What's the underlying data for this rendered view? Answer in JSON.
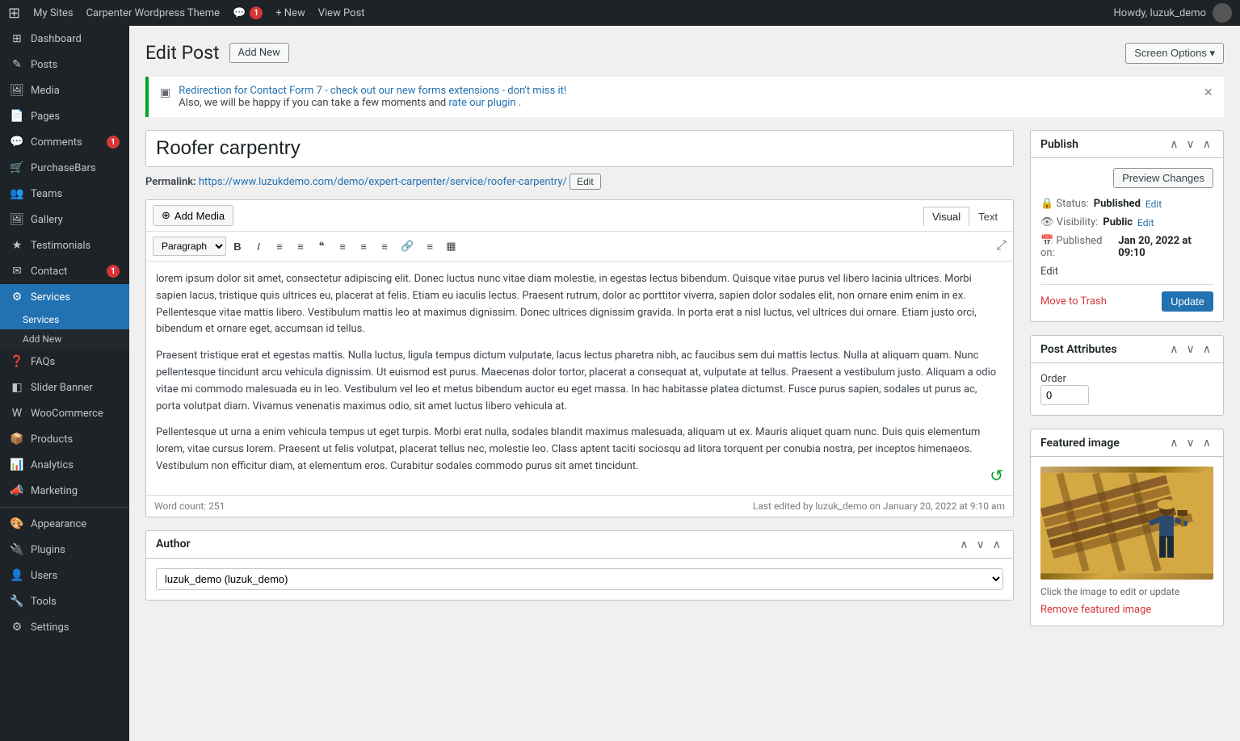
{
  "adminbar": {
    "wp_logo": "⊞",
    "my_sites": "My Sites",
    "theme_name": "Carpenter Wordpress Theme",
    "comments_count": "1",
    "new_label": "+ New",
    "view_post": "View Post",
    "howdy": "Howdy, luzuk_demo"
  },
  "screen_options": "Screen Options ▾",
  "sidebar": {
    "items": [
      {
        "label": "Dashboard",
        "icon": "⊞",
        "active": false
      },
      {
        "label": "Posts",
        "icon": "✎",
        "active": false
      },
      {
        "label": "Media",
        "icon": "🖼",
        "active": false
      },
      {
        "label": "Pages",
        "icon": "📄",
        "active": false
      },
      {
        "label": "Comments",
        "icon": "💬",
        "badge": "1",
        "active": false
      },
      {
        "label": "PurchaseBars",
        "icon": "🛒",
        "active": false
      },
      {
        "label": "Teams",
        "icon": "👥",
        "active": false
      },
      {
        "label": "Gallery",
        "icon": "🖼",
        "active": false
      },
      {
        "label": "Testimonials",
        "icon": "★",
        "active": false
      },
      {
        "label": "Contact",
        "icon": "✉",
        "badge": "1",
        "active": false
      },
      {
        "label": "Services",
        "icon": "⚙",
        "active": true
      },
      {
        "label": "FAQs",
        "icon": "❓",
        "active": false
      },
      {
        "label": "Slider Banner",
        "icon": "◧",
        "active": false
      },
      {
        "label": "WooCommerce",
        "icon": "W",
        "active": false
      },
      {
        "label": "Products",
        "icon": "📦",
        "active": false
      },
      {
        "label": "Analytics",
        "icon": "📊",
        "active": false
      },
      {
        "label": "Marketing",
        "icon": "📣",
        "active": false
      },
      {
        "label": "Appearance",
        "icon": "🎨",
        "active": false
      },
      {
        "label": "Plugins",
        "icon": "🔌",
        "active": false
      },
      {
        "label": "Users",
        "icon": "👤",
        "active": false
      },
      {
        "label": "Tools",
        "icon": "🔧",
        "active": false
      },
      {
        "label": "Settings",
        "icon": "⚙",
        "active": false
      }
    ],
    "submenu": {
      "parent": "Services",
      "items": [
        {
          "label": "Services",
          "active": true
        },
        {
          "label": "Add New",
          "active": false
        }
      ]
    }
  },
  "page": {
    "title": "Edit Post",
    "add_new": "Add New"
  },
  "notice": {
    "link_text": "Redirection for Contact Form 7 - check out our new forms extensions - don't miss it!",
    "body": "Also, we will be happy if you can take a few moments and ",
    "rate_link": "rate our plugin",
    "rate_suffix": "."
  },
  "post": {
    "title": "Roofer carpentry",
    "permalink_label": "Permalink:",
    "permalink_url": "https://www.luzukdemo.com/demo/expert-carpenter/service/roofer-carpentry/",
    "edit_btn": "Edit",
    "content_p1": "lorem ipsum dolor sit amet, consectetur adipiscing elit. Donec luctus nunc vitae diam molestie, in egestas lectus bibendum. Quisque vitae purus vel libero lacinia ultrices. Morbi sapien lacus, tristique quis ultrices eu, placerat at felis. Etiam eu iaculis lectus. Praesent rutrum, dolor ac porttitor viverra, sapien dolor sodales elit, non ornare enim enim in ex. Pellentesque vitae mattis libero. Vestibulum mattis leo at maximus dignissim. Donec ultrices dignissim gravida. In porta erat a nisl luctus, vel ultrices dui ornare. Etiam justo orci, bibendum et ornare eget, accumsan id tellus.",
    "content_p2": "Praesent tristique erat et egestas mattis. Nulla luctus, ligula tempus dictum vulputate, lacus lectus pharetra nibh, ac faucibus sem dui mattis lectus. Nulla at aliquam quam. Nunc pellentesque tincidunt arcu vehicula dignissim. Ut euismod est purus. Maecenas dolor tortor, placerat a consequat at, vulputate at tellus. Praesent a vestibulum justo. Aliquam a odio vitae mi commodo malesuada eu in leo. Vestibulum vel leo et metus bibendum auctor eu eget massa. In hac habitasse platea dictumst. Fusce purus sapien, sodales ut purus ac, porta volutpat diam. Vivamus venenatis maximus odio, sit amet luctus libero vehicula at.",
    "content_p3": "Pellentesque ut urna a enim vehicula tempus ut eget turpis. Morbi erat nulla, sodales blandit maximus malesuada, aliquam ut ex. Mauris aliquet quam nunc. Duis quis elementum lorem, vitae cursus lorem. Praesent ut felis volutpat, placerat tellus nec, molestie leo. Class aptent taciti sociosqu ad litora torquent per conubia nostra, per inceptos himenaeos. Vestibulum non efficitur diam, at elementum eros. Curabitur sodales commodo purus sit amet tincidunt.",
    "word_count": "Word count: 251",
    "last_edited": "Last edited by luzuk_demo on January 20, 2022 at 9:10 am"
  },
  "toolbar": {
    "add_media": "Add Media",
    "visual_tab": "Visual",
    "text_tab": "Text",
    "paragraph_option": "Paragraph",
    "buttons": [
      "B",
      "I",
      "≡",
      "≡",
      "❝",
      "≡",
      "≡",
      "≡",
      "🔗",
      "≡",
      "▦"
    ]
  },
  "publish_box": {
    "title": "Publish",
    "preview_changes": "Preview Changes",
    "status_label": "Status:",
    "status_value": "Published",
    "status_edit": "Edit",
    "visibility_label": "Visibility:",
    "visibility_value": "Public",
    "visibility_edit": "Edit",
    "published_label": "Published on:",
    "published_value": "Jan 20, 2022 at 09:10",
    "published_edit": "Edit",
    "move_to_trash": "Move to Trash",
    "update_btn": "Update"
  },
  "post_attributes": {
    "title": "Post Attributes",
    "order_label": "Order",
    "order_value": "0"
  },
  "featured_image": {
    "title": "Featured image",
    "caption": "Click the image to edit or update",
    "remove_link": "Remove featured image"
  },
  "author_box": {
    "title": "Author",
    "selected": "luzuk_demo (luzuk_demo)"
  }
}
